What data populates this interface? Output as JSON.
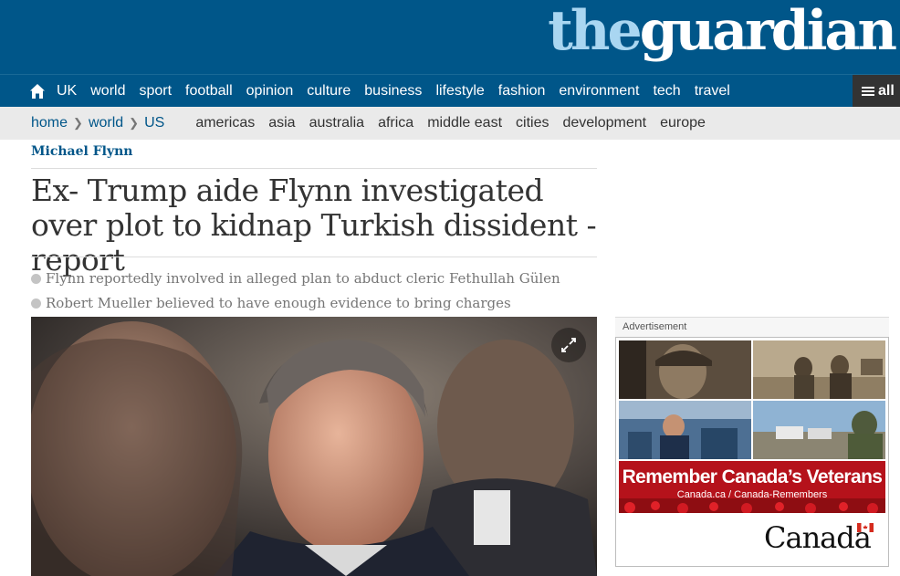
{
  "logo": {
    "the": "the",
    "guardian": "guardian"
  },
  "nav": {
    "items": [
      "UK",
      "world",
      "sport",
      "football",
      "opinion",
      "culture",
      "business",
      "lifestyle",
      "fashion",
      "environment",
      "tech",
      "travel"
    ],
    "all_label": "all"
  },
  "subnav": {
    "breadcrumbs": [
      "home",
      "world",
      "US"
    ],
    "links": [
      "americas",
      "asia",
      "australia",
      "africa",
      "middle east",
      "cities",
      "development",
      "europe"
    ]
  },
  "article": {
    "series": "Michael Flynn",
    "headline": "Ex- Trump aide Flynn investigated over plot to kidnap Turkish dissident - report",
    "standfirst": [
      "Flynn reportedly involved in alleged plan to abduct cleric Fethullah Gülen",
      "Robert Mueller believed to have enough evidence to bring charges"
    ]
  },
  "advert": {
    "label": "Advertisement",
    "title": "Remember Canada’s Veterans",
    "url": "Canada.ca / Canada-Remembers",
    "brand": "Canada"
  },
  "colors": {
    "brand_blue": "#005689",
    "logo_light": "#a9d6f1",
    "ad_red": "#b5121b"
  }
}
